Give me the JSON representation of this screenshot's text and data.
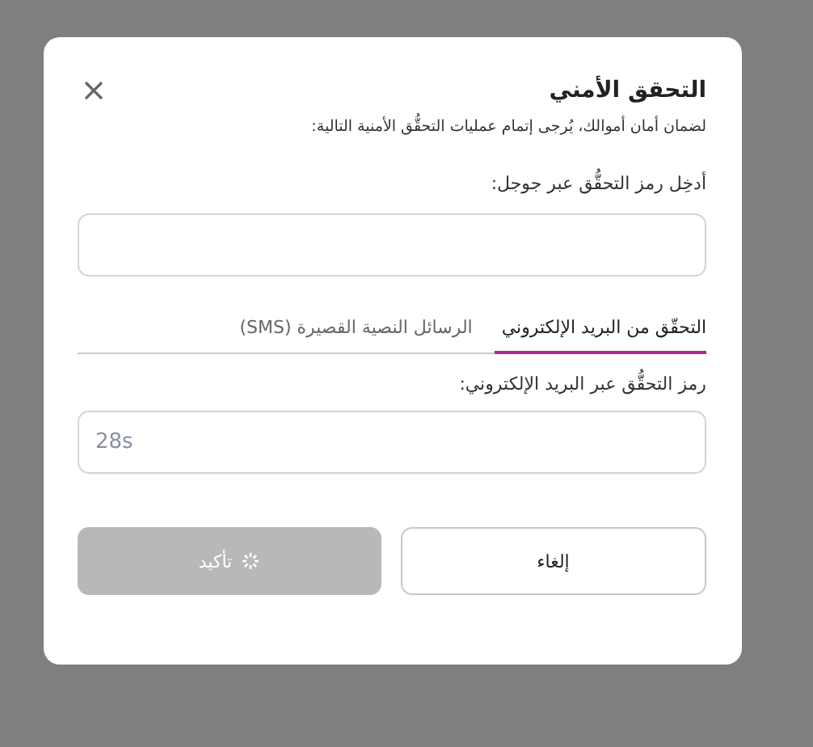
{
  "dialog": {
    "title": "التحقق الأمني",
    "subtitle": "لضمان أمان أموالك، يُرجى إتمام عمليات التحقُّق الأمنية التالية:",
    "google_field": {
      "label": "أدخِل رمز التحقُّق عبر جوجل:"
    },
    "tabs": [
      {
        "label": "التحقّق من البريد الإلكتروني",
        "selected": true
      },
      {
        "label": "الرسائل النصية القصيرة (SMS)",
        "selected": false
      }
    ],
    "email_field": {
      "label": "رمز التحقُّق عبر البريد الإلكتروني:",
      "countdown": "28s"
    },
    "buttons": [
      {
        "label": "إلغاء",
        "kind": "cancel",
        "disabled": false,
        "loading": false
      },
      {
        "label": "تأكيد",
        "kind": "confirm",
        "disabled": true,
        "loading": true
      }
    ]
  }
}
